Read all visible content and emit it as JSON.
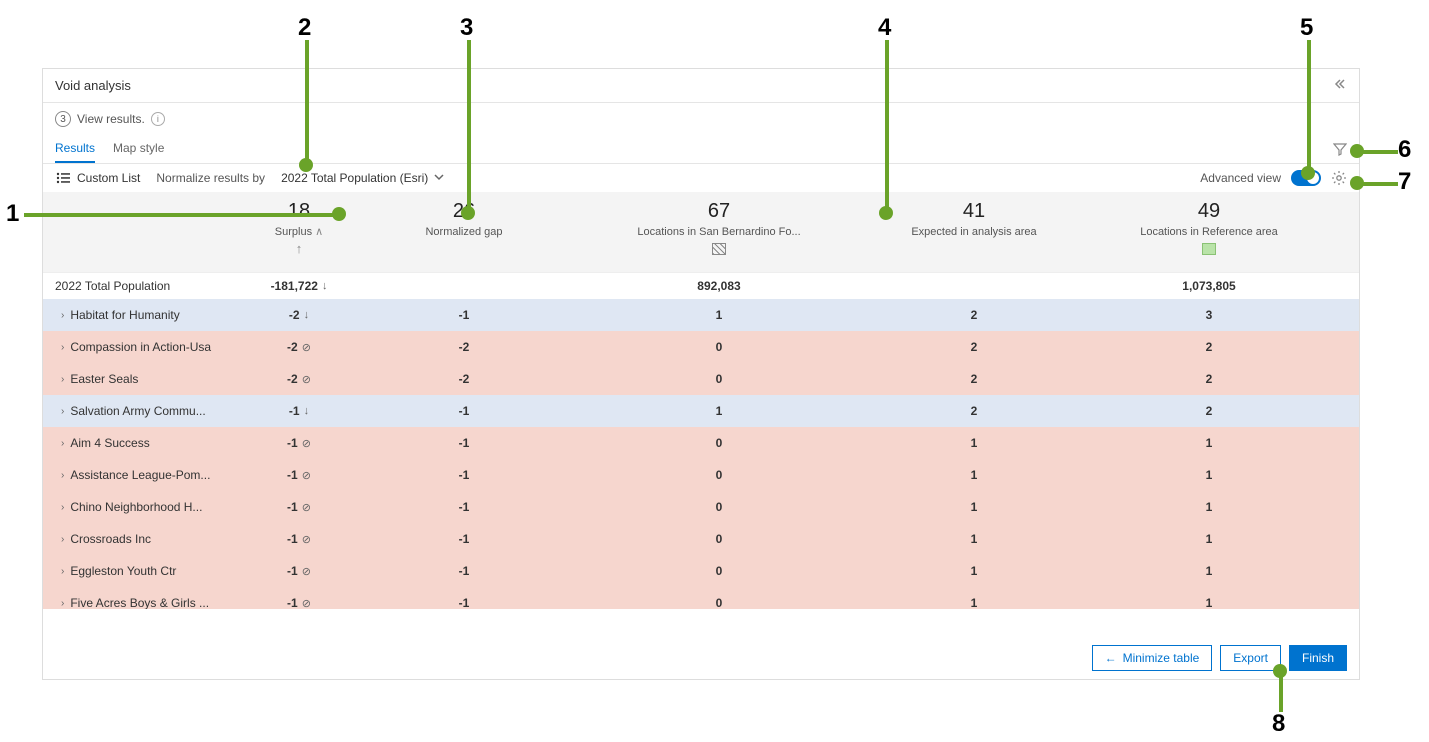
{
  "panel": {
    "title": "Void analysis",
    "step_num": "3",
    "step_text": "View results."
  },
  "tabs": {
    "results": "Results",
    "map_style": "Map style"
  },
  "toolbar": {
    "custom_list": "Custom List",
    "normalize_label": "Normalize results by",
    "normalize_value": "2022 Total Population (Esri)",
    "advanced_view": "Advanced view"
  },
  "columns": {
    "surplus": {
      "num": "18",
      "label": "Surplus"
    },
    "normgap": {
      "num": "26",
      "label": "Normalized gap"
    },
    "locsan": {
      "num": "67",
      "label": "Locations in San Bernardino Fo..."
    },
    "expected": {
      "num": "41",
      "label": "Expected in analysis area"
    },
    "locref": {
      "num": "49",
      "label": "Locations in Reference area"
    }
  },
  "summary": {
    "name": "2022 Total Population",
    "surplus": "-181,722",
    "locsan": "892,083",
    "locref": "1,073,805"
  },
  "rows": [
    {
      "name": "Habitat for Humanity",
      "surplus": "-2",
      "ind": "down",
      "normgap": "-1",
      "locsan": "1",
      "expected": "2",
      "locref": "3",
      "shade": "blue"
    },
    {
      "name": "Compassion in Action-Usa",
      "surplus": "-2",
      "ind": "empty",
      "normgap": "-2",
      "locsan": "0",
      "expected": "2",
      "locref": "2",
      "shade": "red"
    },
    {
      "name": "Easter Seals",
      "surplus": "-2",
      "ind": "empty",
      "normgap": "-2",
      "locsan": "0",
      "expected": "2",
      "locref": "2",
      "shade": "red"
    },
    {
      "name": "Salvation Army Commu...",
      "surplus": "-1",
      "ind": "down",
      "normgap": "-1",
      "locsan": "1",
      "expected": "2",
      "locref": "2",
      "shade": "blue"
    },
    {
      "name": "Aim 4 Success",
      "surplus": "-1",
      "ind": "empty",
      "normgap": "-1",
      "locsan": "0",
      "expected": "1",
      "locref": "1",
      "shade": "red"
    },
    {
      "name": "Assistance League-Pom...",
      "surplus": "-1",
      "ind": "empty",
      "normgap": "-1",
      "locsan": "0",
      "expected": "1",
      "locref": "1",
      "shade": "red"
    },
    {
      "name": "Chino Neighborhood H...",
      "surplus": "-1",
      "ind": "empty",
      "normgap": "-1",
      "locsan": "0",
      "expected": "1",
      "locref": "1",
      "shade": "red"
    },
    {
      "name": "Crossroads Inc",
      "surplus": "-1",
      "ind": "empty",
      "normgap": "-1",
      "locsan": "0",
      "expected": "1",
      "locref": "1",
      "shade": "red"
    },
    {
      "name": "Eggleston Youth Ctr",
      "surplus": "-1",
      "ind": "empty",
      "normgap": "-1",
      "locsan": "0",
      "expected": "1",
      "locref": "1",
      "shade": "red"
    },
    {
      "name": "Five Acres Boys & Girls ...",
      "surplus": "-1",
      "ind": "empty",
      "normgap": "-1",
      "locsan": "0",
      "expected": "1",
      "locref": "1",
      "shade": "red"
    }
  ],
  "footer": {
    "minimize": "Minimize table",
    "export": "Export",
    "finish": "Finish"
  },
  "callouts": {
    "1": "1",
    "2": "2",
    "3": "3",
    "4": "4",
    "5": "5",
    "6": "6",
    "7": "7",
    "8": "8"
  }
}
